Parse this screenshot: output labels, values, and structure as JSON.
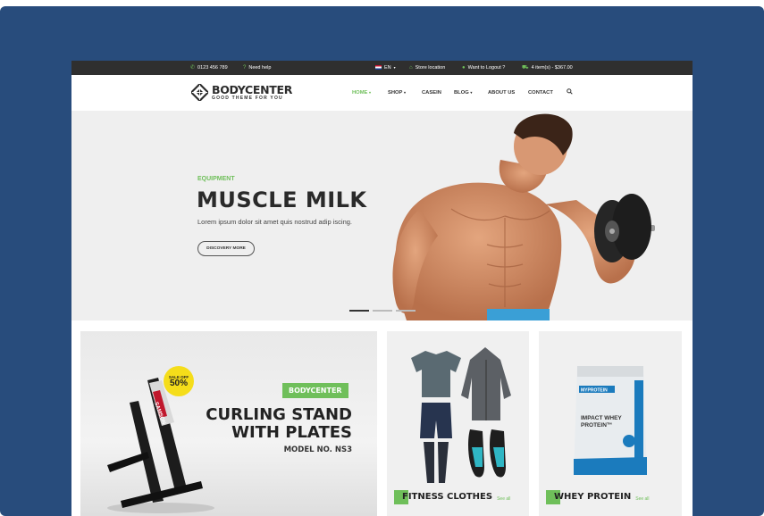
{
  "topbar": {
    "phone": "0123 456 789",
    "help": "Need help",
    "language": "EN",
    "store": "Store location",
    "account": "Want to Logout ?",
    "cart": "4 item(s) - $367.00"
  },
  "logo": {
    "name": "BODYCENTER",
    "tagline": "GOOD THEME FOR YOU"
  },
  "nav": {
    "home": "HOME",
    "shop": "SHOP",
    "casein": "CASEIN",
    "blog": "BLOG",
    "about": "ABOUT US",
    "contact": "CONTACT"
  },
  "hero": {
    "eyebrow": "EQUIPMENT",
    "title": "MUSCLE MILK",
    "subtitle": "Lorem ipsum dolor sit amet quis nostrud adip iscing.",
    "button": "DISCOVERY MORE"
  },
  "banner1": {
    "brand": "BODYCENTER",
    "title_line1": "CURLING STAND",
    "title_line2": "WITH PLATES",
    "model": "MODEL NO. NS3",
    "sale_label": "SALE OFF",
    "sale_value": "50%",
    "rack_text": "SAMSON"
  },
  "banner2": {
    "title": "FITNESS CLOTHES",
    "link": "See all"
  },
  "banner3": {
    "title": "WHEY PROTEIN",
    "link": "See all",
    "pack_brand": "MYPROTEIN",
    "pack_line1": "IMPACT WHEY",
    "pack_line2": "PROTEIN™"
  },
  "colors": {
    "accent": "#6fbf5a",
    "frame": "#284c7c",
    "topbar": "#2f2f2f",
    "sale": "#f5dd1a"
  },
  "icons": [
    "phone-icon",
    "help-icon",
    "store-icon",
    "user-icon",
    "cart-icon",
    "search-icon"
  ]
}
